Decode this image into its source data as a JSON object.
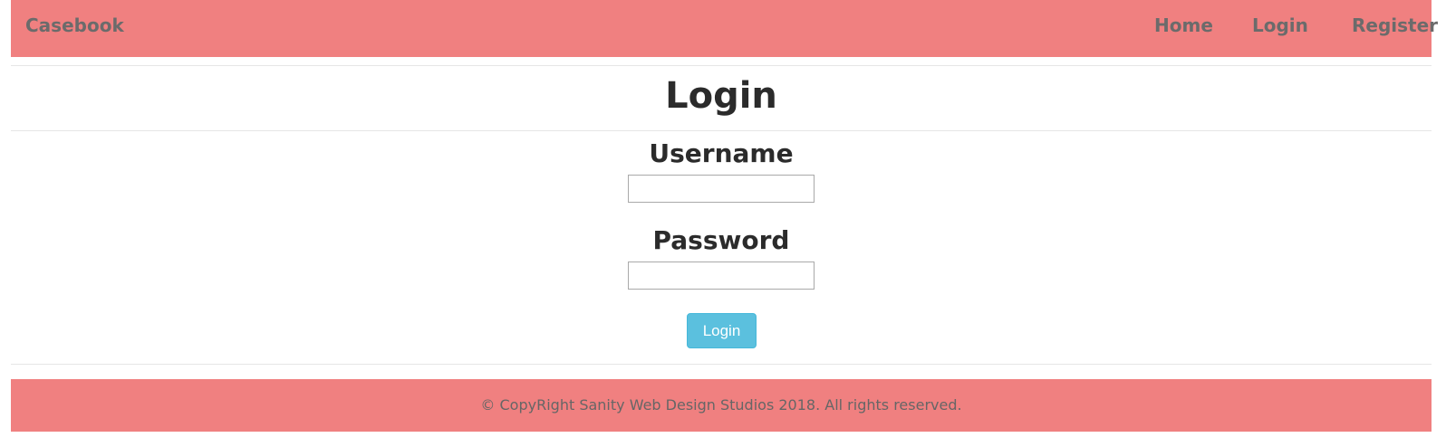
{
  "navbar": {
    "brand": "Casebook",
    "links": {
      "home": "Home",
      "login": "Login",
      "register": "Register"
    }
  },
  "main": {
    "title": "Login",
    "username_label": "Username",
    "username_value": "",
    "password_label": "Password",
    "password_value": "",
    "submit_label": "Login"
  },
  "footer": {
    "text": "© CopyRight Sanity Web Design Studios 2018. All rights reserved."
  },
  "colors": {
    "navbar_bg": "#f08080",
    "footer_bg": "#f08080",
    "button_bg": "#5bc0de",
    "nav_text": "#6b6b6b"
  }
}
